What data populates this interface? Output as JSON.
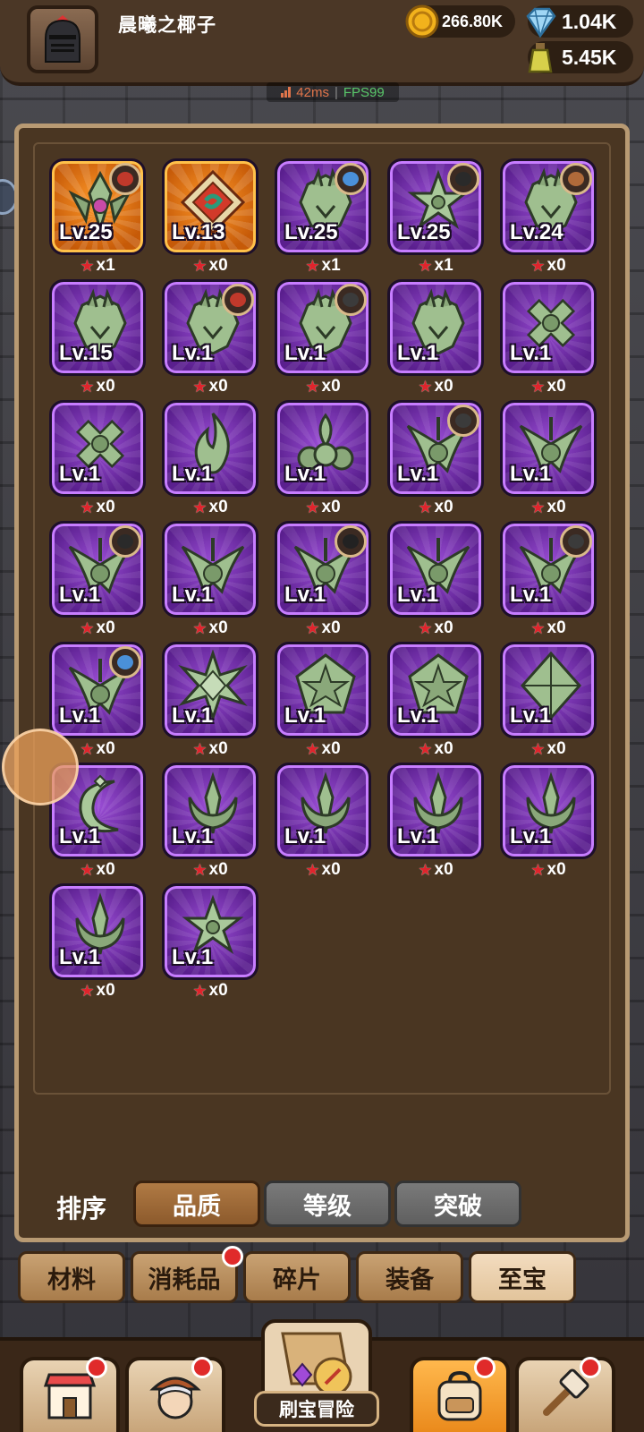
{
  "header": {
    "player_name": "晨曦之椰子",
    "gold": "266.80K",
    "gems": "1.04K",
    "potion": "5.45K"
  },
  "network": {
    "ping": "42ms",
    "fps": "FPS99"
  },
  "items": [
    {
      "level": "Lv.25",
      "count": "x1",
      "rarity": "orange",
      "emblem": "wing-crest",
      "hero": true
    },
    {
      "level": "Lv.13",
      "count": "x0",
      "rarity": "orange",
      "emblem": "diamond-swirl",
      "hero": false
    },
    {
      "level": "Lv.25",
      "count": "x1",
      "rarity": "purple",
      "emblem": "dragon-crest",
      "hero": true
    },
    {
      "level": "Lv.25",
      "count": "x1",
      "rarity": "purple",
      "emblem": "star-laurel",
      "hero": true
    },
    {
      "level": "Lv.24",
      "count": "x0",
      "rarity": "purple",
      "emblem": "dragon-crest",
      "hero": true
    },
    {
      "level": "Lv.15",
      "count": "x0",
      "rarity": "purple",
      "emblem": "dragon-crest",
      "hero": false
    },
    {
      "level": "Lv.1",
      "count": "x0",
      "rarity": "purple",
      "emblem": "dragon-crest",
      "hero": true
    },
    {
      "level": "Lv.1",
      "count": "x0",
      "rarity": "purple",
      "emblem": "dragon-crest",
      "hero": true
    },
    {
      "level": "Lv.1",
      "count": "x0",
      "rarity": "purple",
      "emblem": "dragon-crest",
      "hero": false
    },
    {
      "level": "Lv.1",
      "count": "x0",
      "rarity": "purple",
      "emblem": "cross-knot",
      "hero": false
    },
    {
      "level": "Lv.1",
      "count": "x0",
      "rarity": "purple",
      "emblem": "cross-knot",
      "hero": false
    },
    {
      "level": "Lv.1",
      "count": "x0",
      "rarity": "purple",
      "emblem": "flame",
      "hero": false
    },
    {
      "level": "Lv.1",
      "count": "x0",
      "rarity": "purple",
      "emblem": "fleur",
      "hero": false
    },
    {
      "level": "Lv.1",
      "count": "x0",
      "rarity": "purple",
      "emblem": "wing-badge",
      "hero": true
    },
    {
      "level": "Lv.1",
      "count": "x0",
      "rarity": "purple",
      "emblem": "wing-badge",
      "hero": false
    },
    {
      "level": "Lv.1",
      "count": "x0",
      "rarity": "purple",
      "emblem": "wing-badge",
      "hero": true
    },
    {
      "level": "Lv.1",
      "count": "x0",
      "rarity": "purple",
      "emblem": "wing-badge",
      "hero": false
    },
    {
      "level": "Lv.1",
      "count": "x0",
      "rarity": "purple",
      "emblem": "wing-badge",
      "hero": true
    },
    {
      "level": "Lv.1",
      "count": "x0",
      "rarity": "purple",
      "emblem": "wing-badge",
      "hero": false
    },
    {
      "level": "Lv.1",
      "count": "x0",
      "rarity": "purple",
      "emblem": "wing-badge",
      "hero": true
    },
    {
      "level": "Lv.1",
      "count": "x0",
      "rarity": "purple",
      "emblem": "wing-badge",
      "hero": true
    },
    {
      "level": "Lv.1",
      "count": "x0",
      "rarity": "purple",
      "emblem": "star-burst",
      "hero": false
    },
    {
      "level": "Lv.1",
      "count": "x0",
      "rarity": "purple",
      "emblem": "pentagon-star",
      "hero": false
    },
    {
      "level": "Lv.1",
      "count": "x0",
      "rarity": "purple",
      "emblem": "pentagon-star",
      "hero": false
    },
    {
      "level": "Lv.1",
      "count": "x0",
      "rarity": "purple",
      "emblem": "diamond-spike",
      "hero": false
    },
    {
      "level": "Lv.1",
      "count": "x0",
      "rarity": "purple",
      "emblem": "crescent",
      "hero": false
    },
    {
      "level": "Lv.1",
      "count": "x0",
      "rarity": "purple",
      "emblem": "trident",
      "hero": false
    },
    {
      "level": "Lv.1",
      "count": "x0",
      "rarity": "purple",
      "emblem": "trident",
      "hero": false
    },
    {
      "level": "Lv.1",
      "count": "x0",
      "rarity": "purple",
      "emblem": "trident",
      "hero": false
    },
    {
      "level": "Lv.1",
      "count": "x0",
      "rarity": "purple",
      "emblem": "trident",
      "hero": false
    },
    {
      "level": "Lv.1",
      "count": "x0",
      "rarity": "purple",
      "emblem": "trident",
      "hero": false
    },
    {
      "level": "Lv.1",
      "count": "x0",
      "rarity": "purple",
      "emblem": "star-laurel",
      "hero": false
    }
  ],
  "sort": {
    "label": "排序",
    "options": [
      "品质",
      "等级",
      "突破"
    ],
    "active": "品质"
  },
  "categories": {
    "tabs": [
      "材料",
      "消耗品",
      "碎片",
      "装备",
      "至宝"
    ],
    "active": "至宝",
    "notify": "消耗品"
  },
  "bottom_nav": {
    "adventure_label": "刷宝冒险",
    "buttons": [
      "shop-icon",
      "hero-icon",
      "adventure-icon",
      "backpack-icon",
      "forge-icon"
    ],
    "active": "backpack-icon"
  },
  "colors": {
    "purple_frame": "#5a1f8e",
    "orange_frame": "#c65a08",
    "panel": "#4a3622",
    "star": "#e0242c"
  }
}
